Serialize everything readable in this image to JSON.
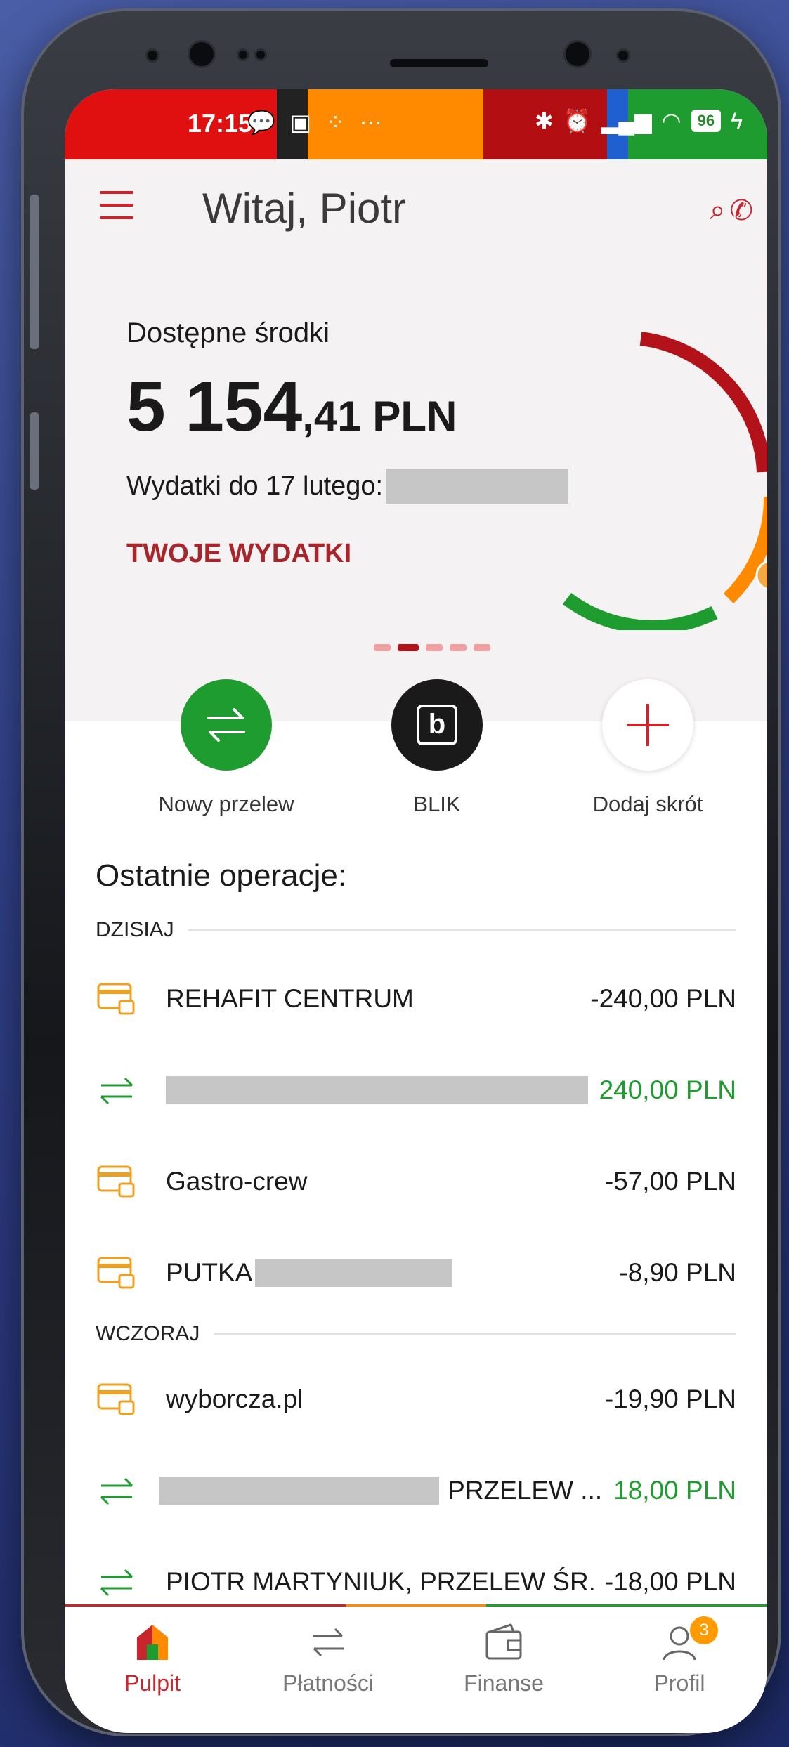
{
  "status_bar": {
    "time": "17:15",
    "left_icons": "💬 ▣ ⁘ ⋯",
    "battery": "96",
    "segment_colors": [
      "#e01010",
      "#222222",
      "#ff8a00",
      "#b30f13",
      "#1f5fd0",
      "#1f9c30"
    ]
  },
  "header": {
    "greeting": "Witaj, Piotr"
  },
  "balance": {
    "label": "Dostępne środki",
    "integer": "5 154",
    "decimal": ",41 PLN",
    "expenses_label": "Wydatki do 17 lutego:",
    "your_expenses_link": "TWOJE WYDATKI",
    "carousel_pages": 5,
    "carousel_active": 1
  },
  "shortcuts": [
    {
      "label": "Nowy przelew",
      "icon": "transfer-icon"
    },
    {
      "label": "BLIK",
      "icon": "blik-icon"
    },
    {
      "label": "Dodaj skrót",
      "icon": "plus-icon"
    }
  ],
  "recent": {
    "title": "Ostatnie operacje:",
    "groups": [
      {
        "day": "DZISIAJ",
        "items": [
          {
            "icon": "card-icon",
            "name": "REHAFIT CENTRUM",
            "amount": "-240,00 PLN",
            "positive": false
          },
          {
            "icon": "transfer-icon",
            "name": "",
            "amount": "240,00 PLN",
            "positive": true
          },
          {
            "icon": "card-icon",
            "name": "Gastro-crew",
            "amount": "-57,00 PLN",
            "positive": false
          },
          {
            "icon": "card-icon",
            "name": "PUTKA",
            "amount": "-8,90 PLN",
            "positive": false
          }
        ]
      },
      {
        "day": "WCZORAJ",
        "items": [
          {
            "icon": "card-icon",
            "name": "wyborcza.pl",
            "amount": "-19,90 PLN",
            "positive": false
          },
          {
            "icon": "transfer-icon",
            "name": "PRZELEW ...",
            "amount": "18,00 PLN",
            "positive": true
          },
          {
            "icon": "transfer-icon",
            "name": "PIOTR MARTYNIUK, PRZELEW ŚR...",
            "amount": "-18,00 PLN",
            "positive": false
          }
        ]
      }
    ]
  },
  "tabs": [
    {
      "label": "Pulpit",
      "icon": "home-icon",
      "active": true
    },
    {
      "label": "Płatności",
      "icon": "transfer-icon",
      "active": false
    },
    {
      "label": "Finanse",
      "icon": "wallet-icon",
      "active": false
    },
    {
      "label": "Profil",
      "icon": "profile-icon",
      "active": false,
      "badge": "3"
    }
  ],
  "colors": {
    "brand_red": "#c8262c",
    "positive_green": "#1f9c30",
    "card_orange": "#f0a020"
  }
}
